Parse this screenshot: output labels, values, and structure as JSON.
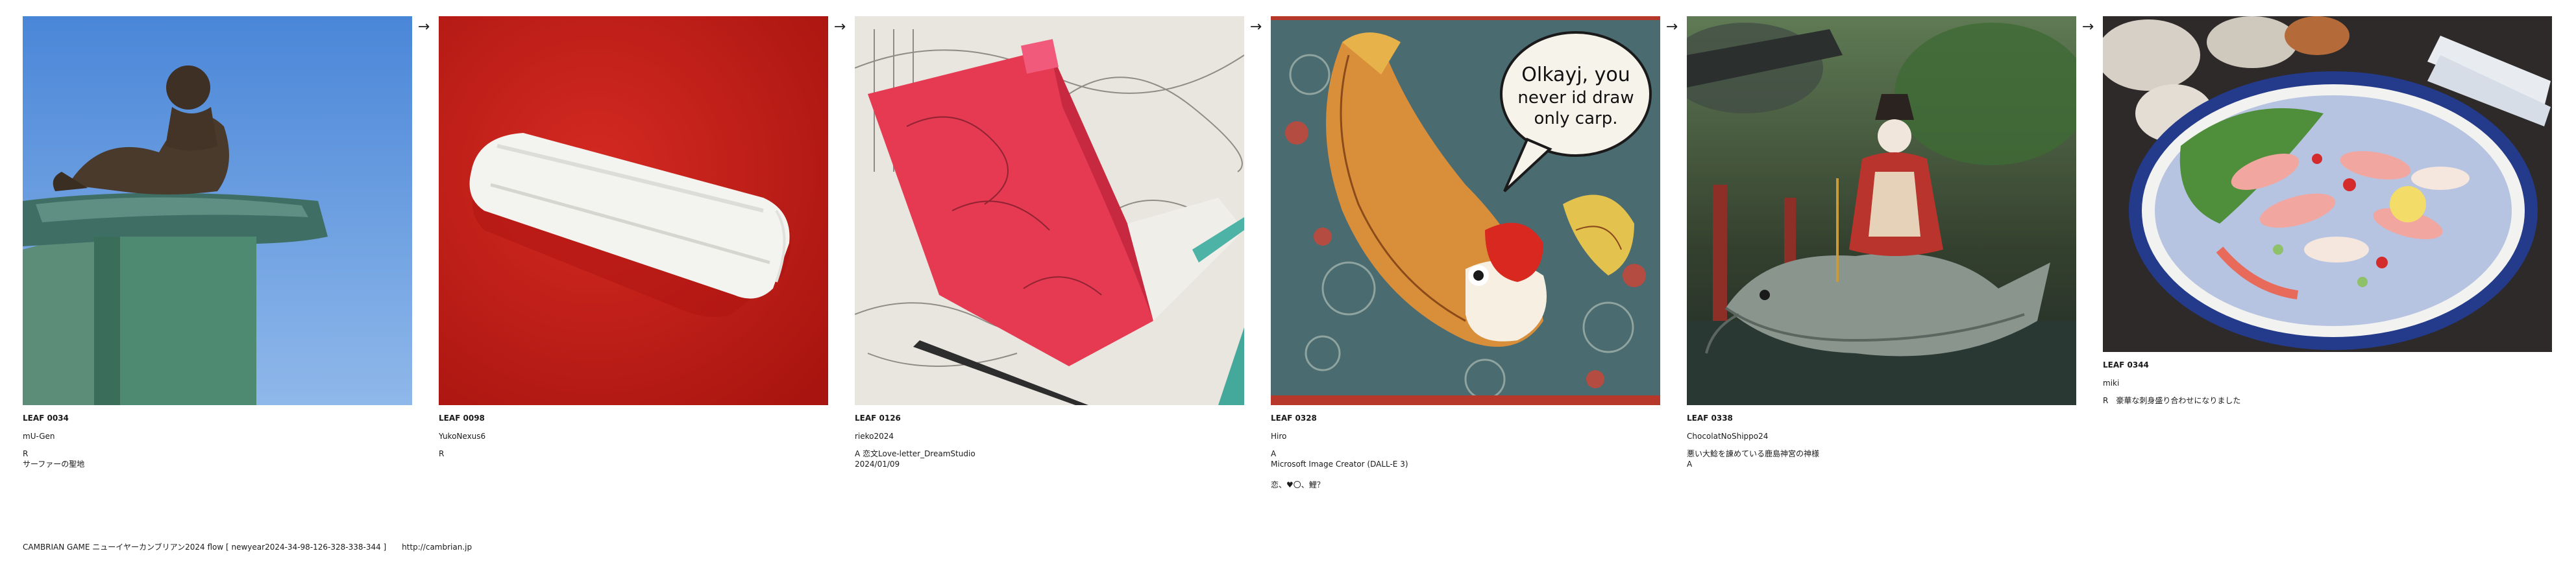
{
  "arrow_glyph": "→",
  "cards": [
    {
      "id": "LEAF 0034",
      "author": "mU-Gen",
      "kind": "R",
      "lines": [
        "サーファーの聖地"
      ],
      "image_icon": "statue-on-pillar-photo"
    },
    {
      "id": "LEAF 0098",
      "author": "YukoNexus6",
      "kind": "R",
      "lines": [],
      "image_icon": "rolled-towel-photo"
    },
    {
      "id": "LEAF 0126",
      "author": "rieko2024",
      "kind": "A 恋文Love-letter_DreamStudio",
      "lines": [
        "2024/01/09"
      ],
      "image_icon": "red-letter-sketch-image"
    },
    {
      "id": "LEAF 0328",
      "author": "Hiro",
      "kind": "A",
      "lines": [
        "Microsoft Image Creator (DALL-E 3)"
      ],
      "extra": "恋、♥〇、鯉？",
      "image_icon": "carp-speech-bubble-illustration",
      "bubble_lines": [
        "Olkayj, you",
        "never id draw",
        "only carp."
      ]
    },
    {
      "id": "LEAF 0338",
      "author": "ChocolatNoShippo24",
      "kind": "悪い大鯰を諌めている鹿島神宮の神様",
      "lines": [
        "A"
      ],
      "image_icon": "deity-riding-catfish-image"
    },
    {
      "id": "LEAF 0344",
      "author": "miki",
      "kind": "R　豪華な刺身盛り合わせになりました",
      "lines": [],
      "image_icon": "sashimi-platter-photo"
    }
  ],
  "footer": {
    "text": "CAMBRIAN GAME  ニューイヤーカンブリアン2024  flow [ newyear2024-34-98-126-328-338-344 ]",
    "link": "http://cambrian.jp"
  }
}
